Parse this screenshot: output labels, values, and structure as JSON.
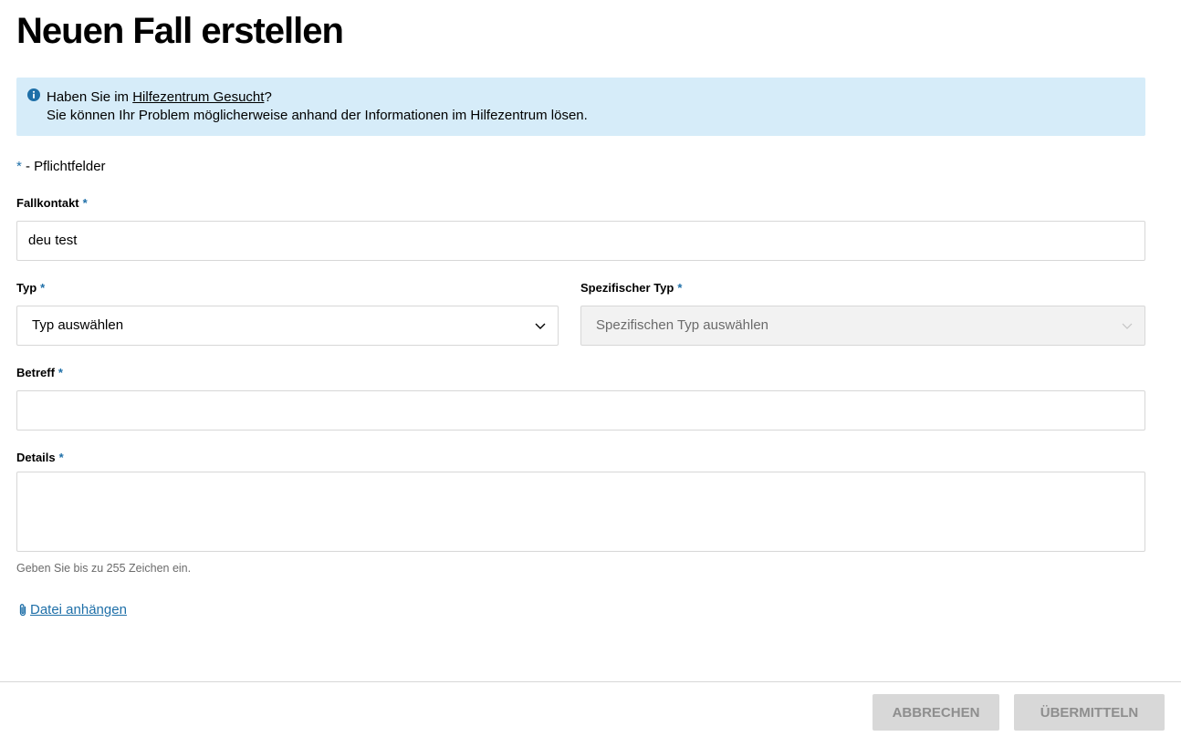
{
  "page": {
    "title": "Neuen Fall erstellen"
  },
  "info": {
    "line1_prefix": "Haben Sie im ",
    "link_text": "Hilfezentrum Gesucht",
    "line1_suffix": "?",
    "line2": "Sie können Ihr Problem möglicherweise anhand der Informationen im Hilfezentrum lösen.",
    "icon": "info-icon"
  },
  "required_note": {
    "star": "*",
    "text": " - Pflichtfelder"
  },
  "form": {
    "contact": {
      "label": "Fallkontakt",
      "star": "*",
      "value": "deu test"
    },
    "type": {
      "label": "Typ",
      "star": "*",
      "value": "Typ auswählen"
    },
    "specific_type": {
      "label": "Spezifischer Typ",
      "star": "*",
      "value": "Spezifischen Typ auswählen"
    },
    "subject": {
      "label": "Betreff",
      "star": "*",
      "value": ""
    },
    "details": {
      "label": "Details",
      "star": "*",
      "value": "",
      "hint": "Geben Sie bis zu 255 Zeichen ein."
    },
    "attach": {
      "label": "Datei anhängen",
      "icon": "paperclip-icon"
    }
  },
  "footer": {
    "cancel_label": "ABBRECHEN",
    "submit_label": "ÜBERMITTELN"
  },
  "colors": {
    "accent": "#1e6fa8",
    "info_bg": "#d6ecf9",
    "button_disabled_bg": "#d8d8d8",
    "button_disabled_text": "#8e8e8e"
  }
}
